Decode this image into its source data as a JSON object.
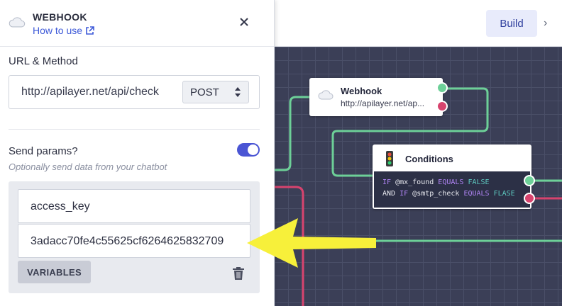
{
  "panel": {
    "title": "WEBHOOK",
    "how_to_use": "How to use",
    "url_method_label": "URL & Method",
    "url_value": "http://apilayer.net/api/check",
    "method": "POST",
    "send_params_label": "Send params?",
    "send_params_enabled": true,
    "send_params_hint": "Optionally send data from your chatbot",
    "params": {
      "key": "access_key",
      "value": "3adacc70fe4c55625cf6264625832709"
    },
    "variables_button": "VARIABLES"
  },
  "toolbar": {
    "build_label": "Build",
    "chevron": "›"
  },
  "canvas": {
    "webhook_node": {
      "title": "Webhook",
      "subtitle": "http://apilayer.net/ap..."
    },
    "conditions_node": {
      "title": "Conditions",
      "line1": {
        "if": "IF",
        "var": "@mx_found",
        "op": "EQUALS",
        "val": "FALSE"
      },
      "line2": {
        "and": "AND",
        "if": "IF",
        "var": "@smtp_check",
        "op": "EQUALS",
        "val": "FLASE"
      }
    }
  },
  "colors": {
    "accent": "#3d59d8",
    "toggle_on": "#4a55d4",
    "canvas_bg": "#3b3f57",
    "wire_green": "#6dd098",
    "wire_red": "#d7436e",
    "annotation_arrow": "#f7f03a"
  },
  "icons": {
    "panel_icon": "cloud-icon",
    "external_link": "external-link-icon",
    "close": "close-icon",
    "select_arrows": "sort-arrows-icon",
    "delete": "trash-icon",
    "condition_icon": "traffic-light-icon"
  }
}
